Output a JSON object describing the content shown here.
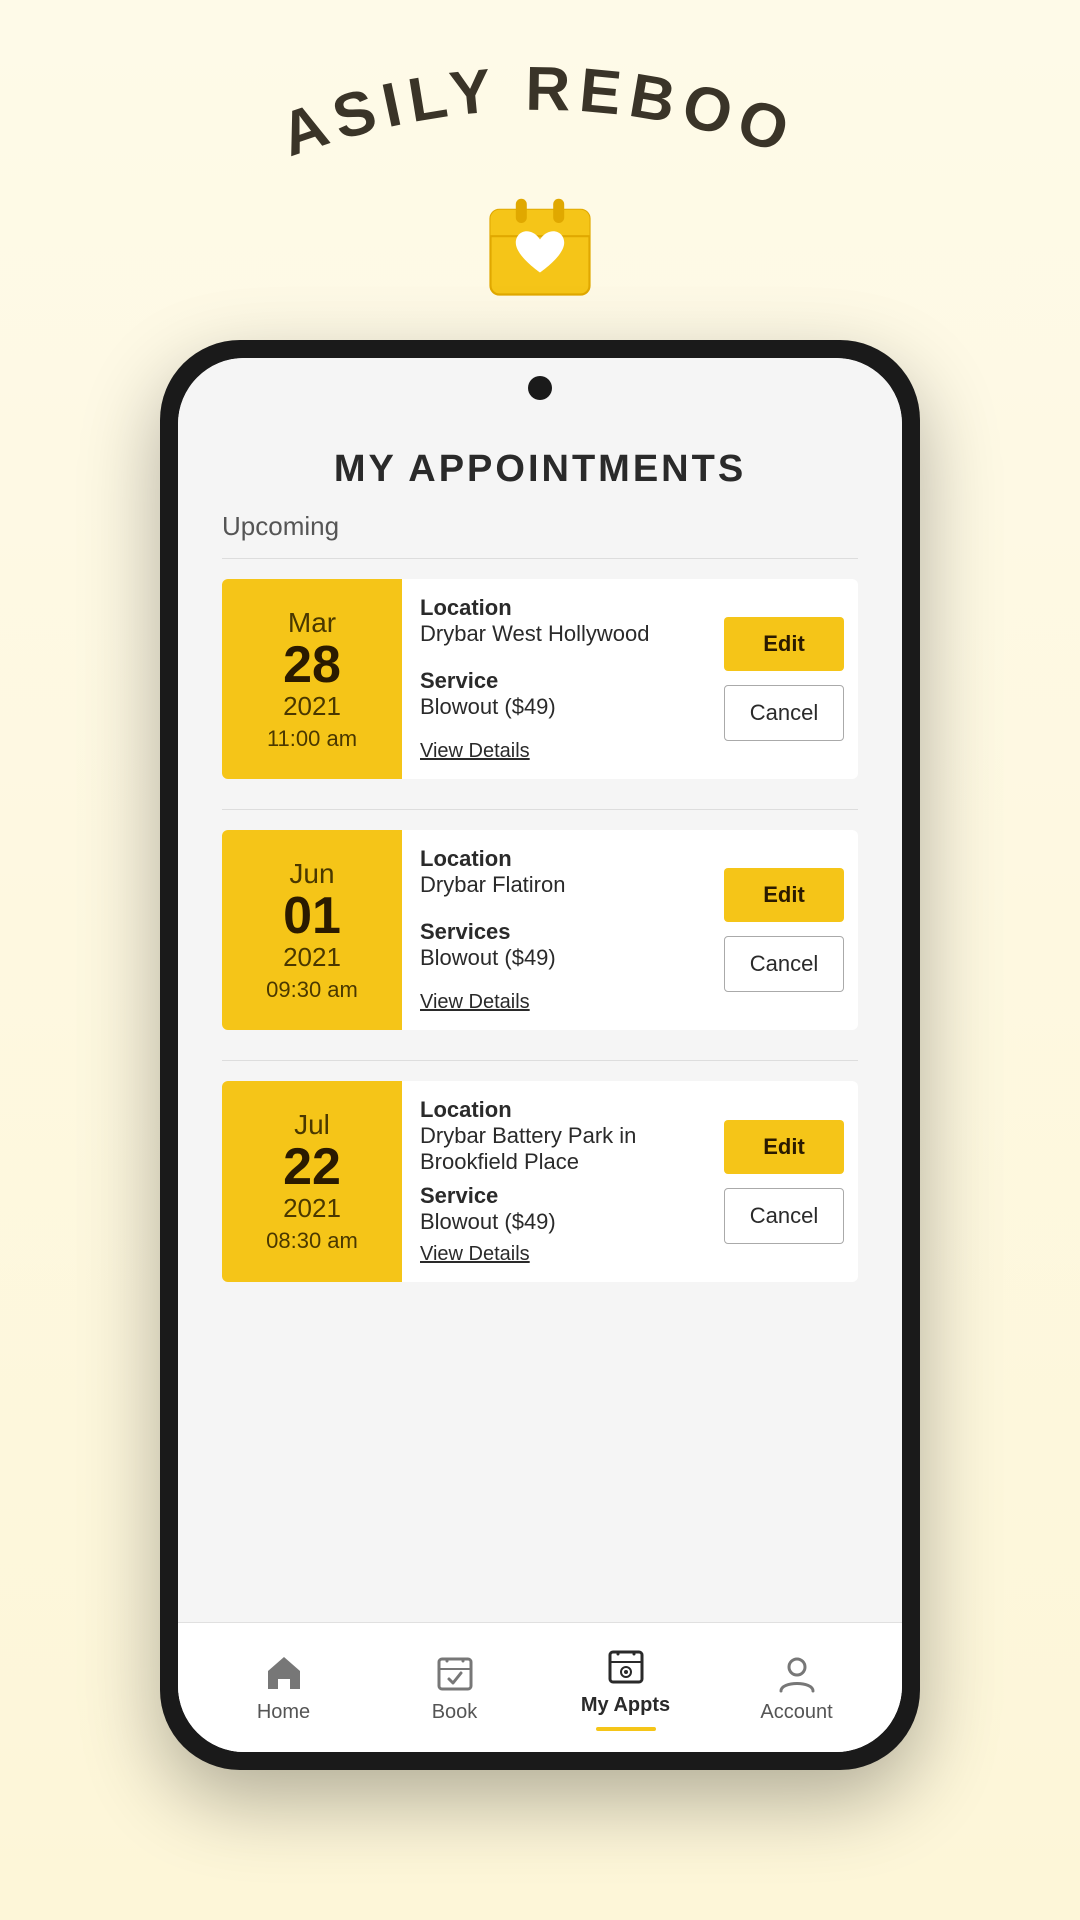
{
  "promo": {
    "title": "EASILY REBOOK",
    "calendar_icon": "calendar-heart-icon"
  },
  "screen": {
    "page_title": "MY APPOINTMENTS",
    "section_label": "Upcoming",
    "appointments": [
      {
        "id": "appt-1",
        "month": "Mar",
        "day": "28",
        "year": "2021",
        "time": "11:00 am",
        "location_label": "Location",
        "location": "Drybar West Hollywood",
        "service_label": "Service",
        "service": "Blowout ($49)",
        "edit_label": "Edit",
        "cancel_label": "Cancel",
        "view_details_label": "View Details"
      },
      {
        "id": "appt-2",
        "month": "Jun",
        "day": "01",
        "year": "2021",
        "time": "09:30 am",
        "location_label": "Location",
        "location": "Drybar Flatiron",
        "service_label": "Services",
        "service": "Blowout ($49)",
        "edit_label": "Edit",
        "cancel_label": "Cancel",
        "view_details_label": "View Details"
      },
      {
        "id": "appt-3",
        "month": "Jul",
        "day": "22",
        "year": "2021",
        "time": "08:30 am",
        "location_label": "Location",
        "location": "Drybar Battery Park in Brookfield Place",
        "service_label": "Service",
        "service": "Blowout ($49)",
        "edit_label": "Edit",
        "cancel_label": "Cancel",
        "view_details_label": "View Details"
      }
    ]
  },
  "nav": {
    "items": [
      {
        "id": "home",
        "label": "Home",
        "active": false
      },
      {
        "id": "book",
        "label": "Book",
        "active": false
      },
      {
        "id": "myappts",
        "label": "My Appts",
        "active": true
      },
      {
        "id": "account",
        "label": "Account",
        "active": false
      }
    ]
  },
  "colors": {
    "yellow": "#f5c518",
    "dark": "#2a2a2a",
    "background": "#fdf6d8"
  }
}
